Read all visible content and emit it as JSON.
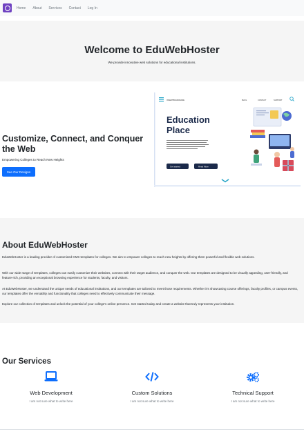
{
  "navbar": {
    "links": [
      "Home",
      "About",
      "Services",
      "Contact",
      "Log In"
    ]
  },
  "hero": {
    "title": "Welcome to EduWebHoster",
    "subtitle": "We provide innovative web solutions for educational institutions."
  },
  "feature": {
    "title": "Customize, Connect, and Conquer the Web",
    "subtitle": "Empowering Colleges to Reach New Heights",
    "button_label": "See Our Designs",
    "illustration": {
      "nav_left": "INSERTBRANDNAME",
      "nav_items": [
        "BLOG",
        "CONTACT",
        "SUPPORT"
      ],
      "heading_line1": "Education",
      "heading_line2": "Place",
      "primary_button": "Get started",
      "secondary_button": "Read More"
    }
  },
  "about": {
    "title": "About EduWebHoster",
    "paragraphs": [
      "EduWebHoster is a leading provider of customized CMS templates for colleges. We aim to empower colleges to reach new heights by offering them powerful and flexible web solutions.",
      "With our wide range of templates, colleges can easily customize their websites, connect with their target audience, and conquer the web. Our templates are designed to be visually appealing, user-friendly, and feature-rich, providing an exceptional browsing experience for students, faculty, and visitors.",
      "At EduWebHoster, we understand the unique needs of educational institutions, and our templates are tailored to meet those requirements. Whether it's showcasing course offerings, faculty profiles, or campus events, our templates offer the versatility and functionality that colleges need to effectively communicate their message.",
      "Explore our collection of templates and unlock the potential of your college's online presence. Get started today and create a website that truly represents your institution."
    ]
  },
  "services": {
    "title": "Our Services",
    "accent_color": "#0d6efd",
    "items": [
      {
        "name": "Web Development",
        "desc": "I am not sure what to write here",
        "icon": "laptop-icon"
      },
      {
        "name": "Custom Solutions",
        "desc": "I am not sure what to write here",
        "icon": "code-icon"
      },
      {
        "name": "Technical Support",
        "desc": "I am not sure what to write here",
        "icon": "gears-icon"
      }
    ]
  }
}
